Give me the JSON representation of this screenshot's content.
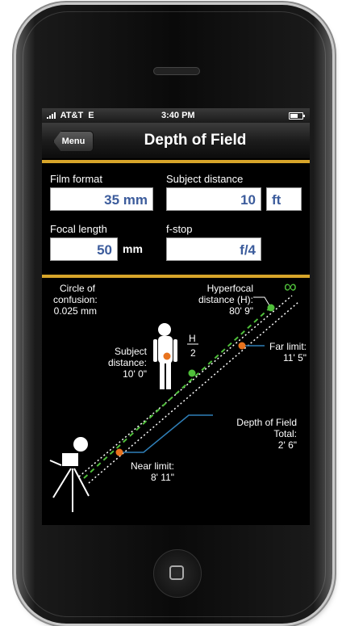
{
  "status": {
    "carrier": "AT&T",
    "network": "E",
    "time": "3:40 PM"
  },
  "nav": {
    "menu_label": "Menu",
    "title": "Depth of Field"
  },
  "form": {
    "film_format": {
      "label": "Film format",
      "value": "35 mm"
    },
    "subject_distance": {
      "label": "Subject distance",
      "value": "10",
      "unit": "ft"
    },
    "focal_length": {
      "label": "Focal length",
      "value": "50",
      "unit": "mm"
    },
    "fstop": {
      "label": "f-stop",
      "value": "f/4"
    }
  },
  "diagram": {
    "coc_line1": "Circle of",
    "coc_line2": "confusion:",
    "coc_value": "0.025 mm",
    "hyperfocal_line1": "Hyperfocal",
    "hyperfocal_line2": "distance (H):",
    "hyperfocal_value": "80' 9\"",
    "infinity": "∞",
    "subject_line1": "Subject",
    "subject_line2": "distance:",
    "subject_value": "10' 0\"",
    "h_numerator": "H",
    "h_denominator": "2",
    "far_label": "Far limit:",
    "far_value": "11' 5\"",
    "dof_line1": "Depth of Field",
    "dof_line2": "Total:",
    "dof_value": "2' 6\"",
    "near_label": "Near limit:",
    "near_value": "8' 11\""
  },
  "colors": {
    "accent_gold": "#d7a52a",
    "value_blue": "#3c5c9c",
    "orange_dot": "#e8731e",
    "green_dot": "#4fbf3a",
    "line_blue": "#2f7fb8"
  }
}
